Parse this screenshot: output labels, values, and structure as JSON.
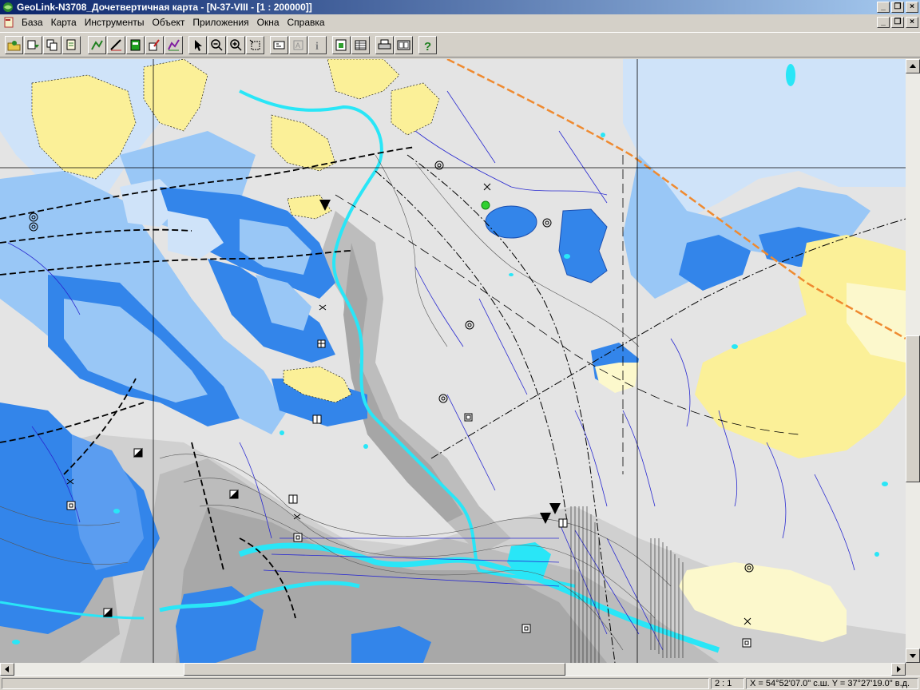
{
  "window": {
    "title": "GeoLink-N3708_Дочетвертичная карта - [N-37-VIII - [1 : 200000]]"
  },
  "menu": {
    "items": [
      "База",
      "Карта",
      "Инструменты",
      "Объект",
      "Приложения",
      "Окна",
      "Справка"
    ]
  },
  "toolbar": {
    "icons": [
      "open-db",
      "save-db",
      "copy-db",
      "layers",
      "edit-layer",
      "edit-line",
      "edit-fill",
      "edit-symbol",
      "edit-poly",
      "select",
      "zoom-out",
      "zoom-in",
      "zoom-rect",
      "info-1",
      "info-2",
      "info",
      "new-doc",
      "table",
      "print",
      "export",
      "help"
    ]
  },
  "status": {
    "scale": "2 : 1",
    "coords": "X = 54°52'07.0\" с.ш.  Y = 37°27'19.0\" в.д."
  },
  "colors": {
    "deep_blue": "#3385ea",
    "mid_blue": "#99c7f6",
    "light_blue": "#cfe3f9",
    "yellow": "#fbf098",
    "pale_yellow": "#fcf8cc",
    "cyan": "#29e6f7",
    "grey_dark": "#a4a4a4",
    "grey_mid": "#bcbcbc",
    "grey_light": "#d6d6d6",
    "river_line": "#2828d0",
    "boundary_orange": "#ef8a30"
  }
}
